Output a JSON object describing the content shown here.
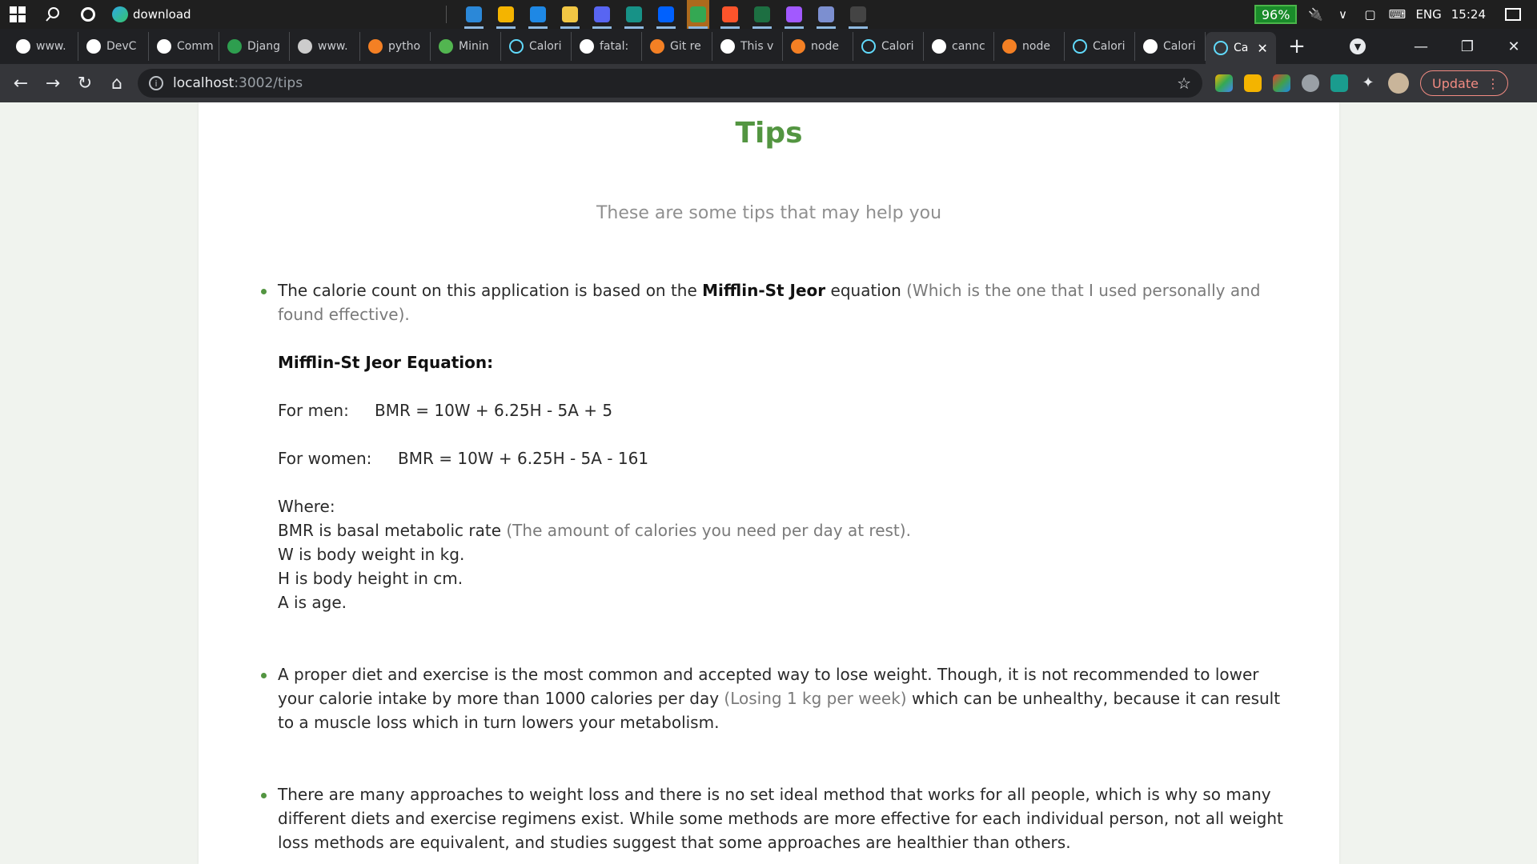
{
  "taskbar": {
    "download_label": "download",
    "battery": "96%",
    "language": "ENG",
    "clock": "15:24",
    "apps": [
      {
        "icon": "mail-icon",
        "color": "#2b88d8"
      },
      {
        "icon": "chrome-icon",
        "color": "#f4b400"
      },
      {
        "icon": "vscode-icon",
        "color": "#1e88e5"
      },
      {
        "icon": "file-explorer-icon",
        "color": "#f2c744"
      },
      {
        "icon": "discord-icon",
        "color": "#5865f2"
      },
      {
        "icon": "gitkraken-icon",
        "color": "#179287"
      },
      {
        "icon": "dropbox-icon",
        "color": "#0061fe"
      },
      {
        "icon": "google-drive-icon",
        "color": "#34a853"
      },
      {
        "icon": "brave-icon",
        "color": "#fb542b"
      },
      {
        "icon": "excel-icon",
        "color": "#1d6f42"
      },
      {
        "icon": "figma-icon",
        "color": "#a259ff"
      },
      {
        "icon": "git-icon",
        "color": "#7c8fd0"
      },
      {
        "icon": "terminal-icon",
        "color": "#444444"
      }
    ]
  },
  "tabs": [
    {
      "title": "www.",
      "favicon": "google-icon",
      "color": "#ffffff"
    },
    {
      "title": "DevC",
      "favicon": "github-icon",
      "color": "#ffffff"
    },
    {
      "title": "Comm",
      "favicon": "github-icon",
      "color": "#ffffff"
    },
    {
      "title": "Djang",
      "favicon": "django-leaf-icon",
      "color": "#2e9e4f"
    },
    {
      "title": "www.",
      "favicon": "globe-icon",
      "color": "#cccccc"
    },
    {
      "title": "pytho",
      "favicon": "stackoverflow-icon",
      "color": "#f48024"
    },
    {
      "title": "Minin",
      "favicon": "regex-icon",
      "color": "#52b550"
    },
    {
      "title": "Calori",
      "favicon": "react-icon",
      "color": "#61dafb"
    },
    {
      "title": "fatal:",
      "favicon": "google-icon",
      "color": "#ffffff"
    },
    {
      "title": "Git re",
      "favicon": "stackoverflow-icon",
      "color": "#f48024"
    },
    {
      "title": "This v",
      "favicon": "google-icon",
      "color": "#ffffff"
    },
    {
      "title": "node",
      "favicon": "stackoverflow-icon",
      "color": "#f48024"
    },
    {
      "title": "Calori",
      "favicon": "react-icon",
      "color": "#61dafb"
    },
    {
      "title": "cannc",
      "favicon": "google-icon",
      "color": "#ffffff"
    },
    {
      "title": "node",
      "favicon": "stackoverflow-icon",
      "color": "#f48024"
    },
    {
      "title": "Calori",
      "favicon": "react-icon",
      "color": "#61dafb"
    },
    {
      "title": "Calori",
      "favicon": "github-icon",
      "color": "#ffffff"
    }
  ],
  "active_tab": {
    "title": "Ca",
    "favicon": "react-icon",
    "color": "#61dafb"
  },
  "address": {
    "host": "localhost",
    "path": ":3002/tips"
  },
  "update_label": "Update",
  "page": {
    "title": "Tips",
    "subtitle": "These are some tips that may help you",
    "tip1": {
      "intro": "The calorie count on this application is based on the ",
      "equation_name": "Mifflin-St Jeor",
      "after_name": " equation ",
      "note": "(Which is the one that I used personally and found effective).",
      "eq_heading": "Mifflin-St Jeor Equation:",
      "men_label": "For men:",
      "men_formula": "BMR = 10W + 6.25H - 5A + 5",
      "women_label": "For women:",
      "women_formula": "BMR = 10W + 6.25H - 5A - 161",
      "where": "Where:",
      "bmr_def": "BMR is basal metabolic rate ",
      "bmr_note": "(The amount of calories you need per day at rest).",
      "w_def": "W is body weight in kg.",
      "h_def": "H is body height in cm.",
      "a_def": "A is age."
    },
    "tip2": {
      "text_a": "A proper diet and exercise is the most common and accepted way to lose weight. Though, it is not recommended to lower your calorie intake by more than 1000 calories per day ",
      "note": "(Losing 1 kg per week)",
      "text_b": " which can be unhealthy, because it can result to a muscle loss which in turn lowers your metabolism."
    },
    "tip3": {
      "text": "There are many approaches to weight loss and there is no set ideal method that works for all people, which is why so many different diets and exercise regimens exist. While some methods are more effective for each individual person, not all weight loss methods are equivalent, and studies suggest that some approaches are healthier than others."
    }
  }
}
